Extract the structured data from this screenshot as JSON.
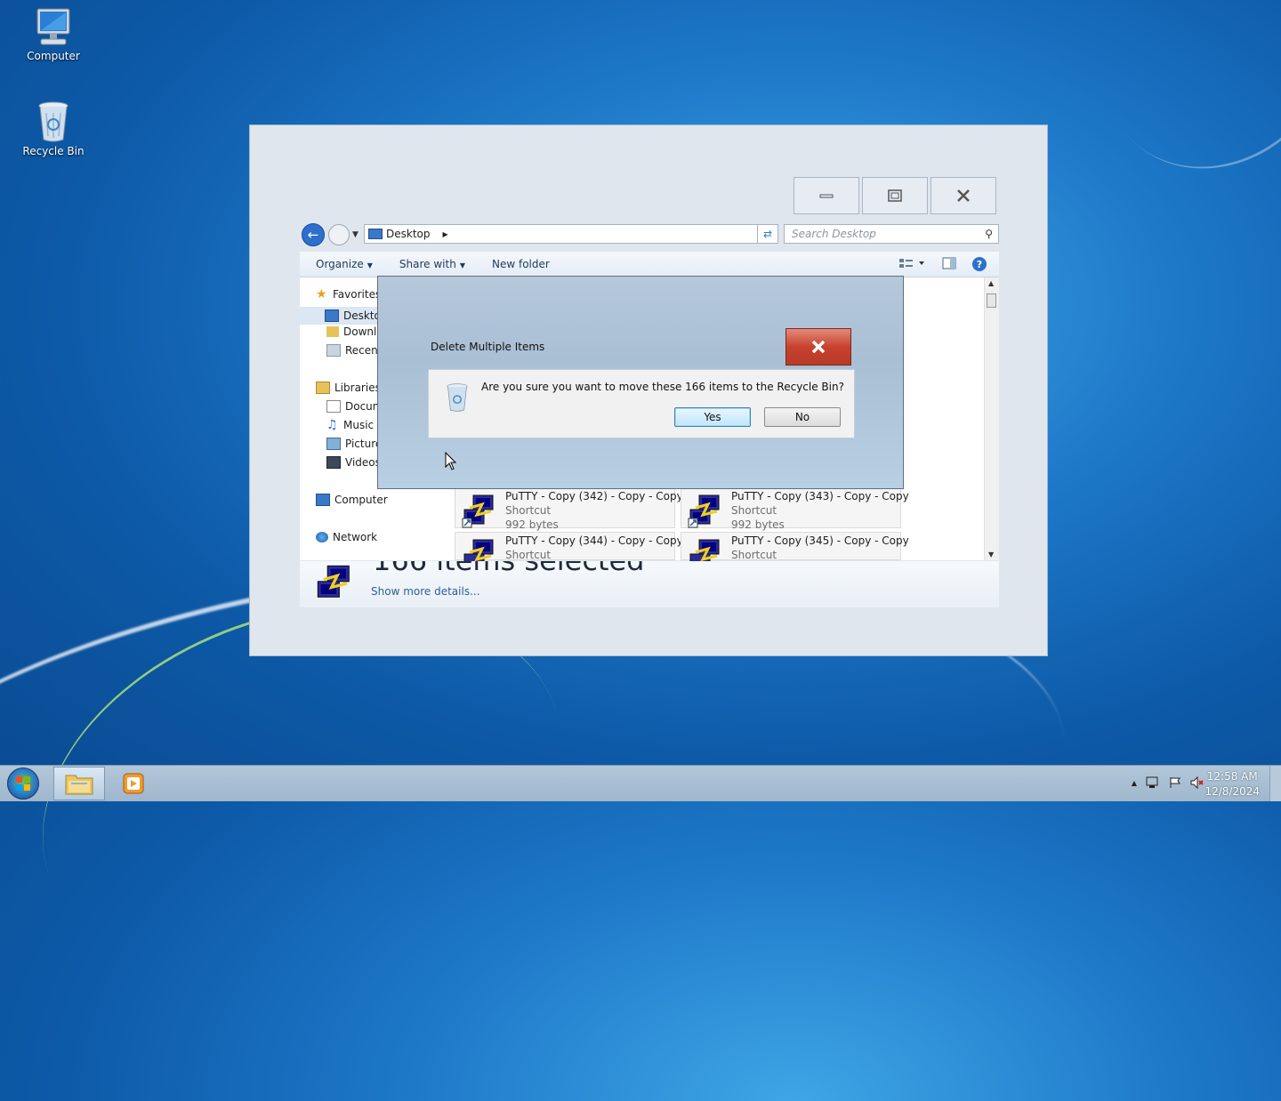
{
  "desktop": {
    "icons": [
      {
        "label": "Computer",
        "icon": "computer-icon"
      },
      {
        "label": "Recycle Bin",
        "icon": "recycle-bin-icon"
      }
    ]
  },
  "explorer": {
    "address": {
      "crumb": "Desktop"
    },
    "search": {
      "placeholder": "Search Desktop"
    },
    "toolbar": {
      "organize": "Organize",
      "share_with": "Share with",
      "new_folder": "New folder",
      "help": "?"
    },
    "nav": {
      "favorites": "Favorites",
      "desktop": "Deskto",
      "downloads": "Downl",
      "recent": "Recent",
      "libraries": "Libraries",
      "documents": "Docum",
      "music": "Music",
      "pictures": "Picture",
      "videos": "Videos",
      "computer": "Computer",
      "network": "Network"
    },
    "files": [
      {
        "name": "PuTTY - Copy (342) - Copy - Copy",
        "type": "Shortcut",
        "size": "992 bytes"
      },
      {
        "name": "PuTTY - Copy (343) - Copy - Copy",
        "type": "Shortcut",
        "size": "992 bytes"
      },
      {
        "name": "PuTTY - Copy (344) - Copy - Copy",
        "type": "Shortcut",
        "size": ""
      },
      {
        "name": "PuTTY - Copy (345) - Copy - Copy",
        "type": "Shortcut",
        "size": ""
      }
    ],
    "details": {
      "summary": "166 items selected",
      "show_more": "Show more details..."
    }
  },
  "dialog": {
    "title": "Delete Multiple Items",
    "message": "Are you sure you want to move these 166 items to the Recycle Bin?",
    "yes": "Yes",
    "no": "No"
  },
  "taskbar": {
    "clock_time": "12:58 AM",
    "clock_date": "12/8/2024"
  },
  "colors": {
    "desktop_bg": "#1d78c8",
    "close_red": "#c8412e",
    "accent_blue": "#2d6fcc"
  }
}
